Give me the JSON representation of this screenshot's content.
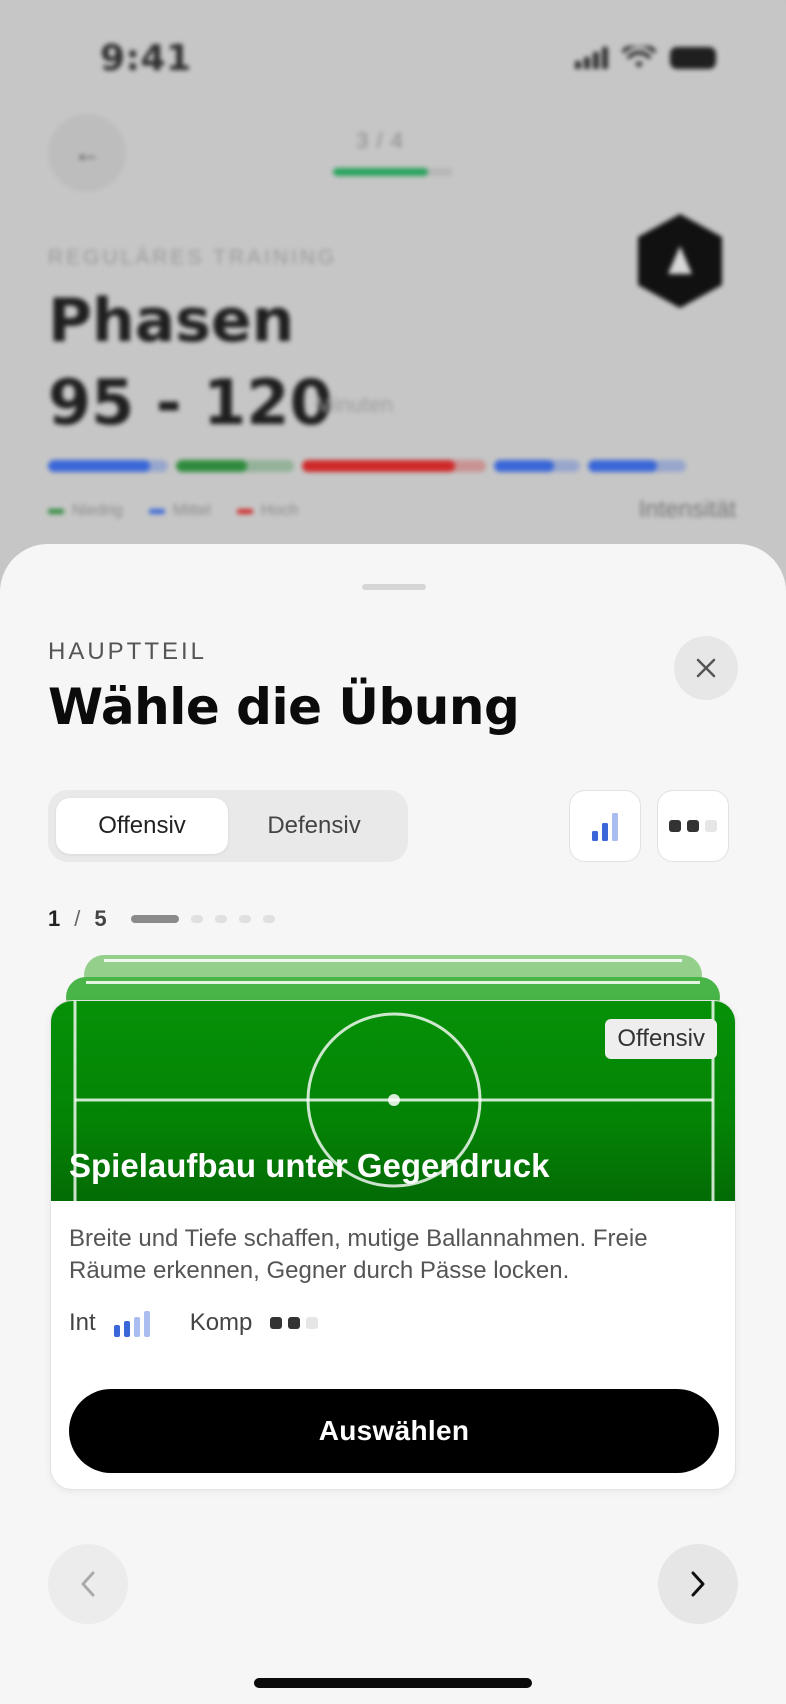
{
  "status_bar": {
    "time": "9:41"
  },
  "header": {
    "step_label": "3 / 4",
    "step_progress": 0.79
  },
  "training": {
    "type_label": "REGULÄRES TRAINING",
    "title": "Phasen",
    "duration": "95 - 120",
    "duration_unit": "Minuten",
    "intensity_label": "Intensität",
    "legend": [
      {
        "label": "Niedrig",
        "color": "#2e8b3d"
      },
      {
        "label": "Mittel",
        "color": "#3a67d8"
      },
      {
        "label": "Hoch",
        "color": "#cf2a2a"
      }
    ],
    "phases": [
      {
        "color": "#3a67d8",
        "level": 0.85,
        "width": 120
      },
      {
        "color": "#2e8b3d",
        "level": 0.6,
        "width": 118
      },
      {
        "color": "#cf2a2a",
        "level": 0.83,
        "width": 206
      },
      {
        "color": "#3a67d8",
        "level": 0.7,
        "width": 94
      },
      {
        "color": "#3a67d8",
        "level": 0.7,
        "width": 100
      }
    ]
  },
  "sheet": {
    "eyebrow": "HAUPTTEIL",
    "title": "Wähle die Übung",
    "segments": [
      {
        "label": "Offensiv",
        "active": true
      },
      {
        "label": "Defensiv",
        "active": false
      }
    ],
    "pager": {
      "current": "1",
      "separator": "/",
      "total": "5"
    }
  },
  "card": {
    "tag": "Offensiv",
    "title": "Spielaufbau unter Gegendruck",
    "description": "Breite und Tiefe schaffen, mutige Ballannahmen. Freie Räume erkennen, Gegner durch Pässe locken.",
    "intensity_label": "Int",
    "intensity_level": 2,
    "complexity_label": "Komp",
    "complexity_level": 2,
    "select_label": "Auswählen"
  },
  "colors": {
    "accent_green": "#27a35a",
    "pitch_green": "#069108",
    "bar_blue": "#3a67d8",
    "bar_blue_light": "#a9bdf0"
  }
}
